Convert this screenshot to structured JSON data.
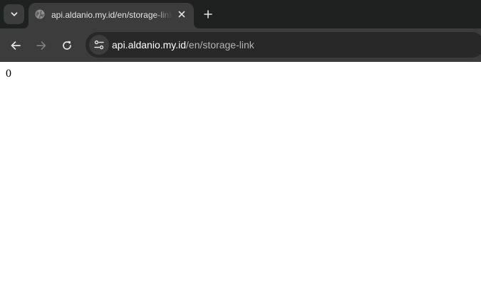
{
  "tab": {
    "title": "api.aldanio.my.id/en/storage-link",
    "favicon_icon": "globe-icon",
    "close_icon": "close-icon"
  },
  "tab_strip": {
    "search_icon": "chevron-down-icon",
    "new_tab_icon": "plus-icon"
  },
  "toolbar": {
    "back_icon": "arrow-left-icon",
    "forward_icon": "arrow-right-icon",
    "reload_icon": "reload-icon",
    "site_info_icon": "tune-icon"
  },
  "address_bar": {
    "host": "api.aldanio.my.id",
    "path": "/en/storage-link"
  },
  "page": {
    "body_text": "0"
  },
  "colors": {
    "tabstrip_bg": "#1f2020",
    "toolbar_bg": "#3c3c3c",
    "omnibox_bg": "#282828",
    "text_primary": "#e3e3e3"
  }
}
